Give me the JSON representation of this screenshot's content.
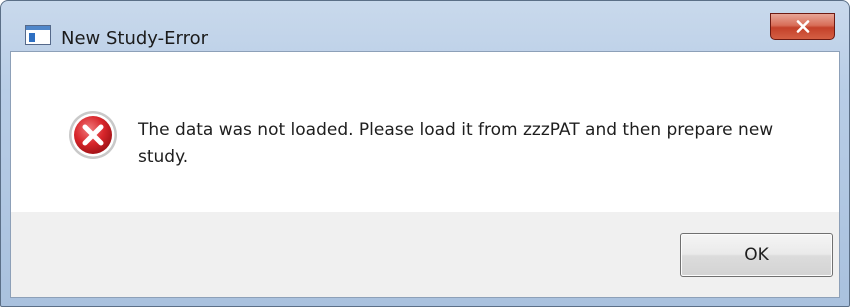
{
  "window": {
    "title": "New Study-Error",
    "app_icon": "window-app-icon",
    "close_icon": "close-icon"
  },
  "dialog": {
    "icon": "error-icon",
    "message": "The data was not loaded. Please load it from zzzPAT and then prepare new study.",
    "ok_label": "OK"
  },
  "colors": {
    "error_red": "#d8262b",
    "close_red": "#c4412a",
    "title_frame": "#b8cde6"
  }
}
